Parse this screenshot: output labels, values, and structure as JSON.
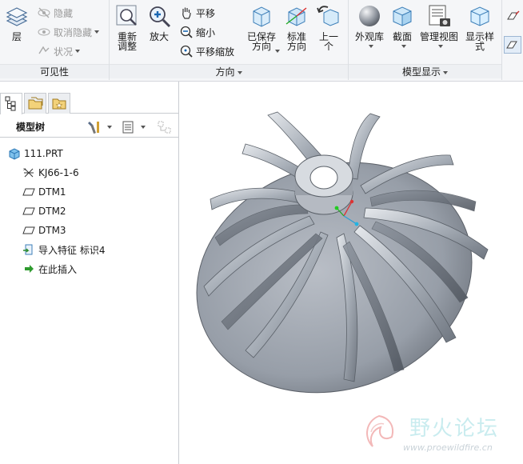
{
  "ribbon": {
    "visibility": {
      "layer_label": "层",
      "hide_label": "隐藏",
      "unhide_label": "取消隐藏",
      "status_label": "状况",
      "group_label": "可见性"
    },
    "orientation": {
      "refit_label": "重新\n调整",
      "zoom_in_label": "放大",
      "pan_label": "平移",
      "zoom_out_label": "缩小",
      "pan_zoom_label": "平移缩放",
      "saved_orientations_label": "已保存\n方向",
      "standard_orientation_label": "标准\n方向",
      "previous_label": "上一\n个",
      "group_label": "方向"
    },
    "model_display": {
      "appearance_gallery_label": "外观库",
      "section_label": "截面",
      "manage_views_label": "管理视图",
      "display_style_label": "显示样\n式",
      "group_label": "模型显示"
    }
  },
  "panel": {
    "tree_title": "模型树",
    "items": [
      {
        "label": "111.PRT",
        "icon": "part-icon"
      },
      {
        "label": "KJ66-1-6",
        "icon": "csys-icon"
      },
      {
        "label": "DTM1",
        "icon": "datum-plane-icon"
      },
      {
        "label": "DTM2",
        "icon": "datum-plane-icon"
      },
      {
        "label": "DTM3",
        "icon": "datum-plane-icon"
      },
      {
        "label": "导入特征 标识4",
        "icon": "import-feature-icon"
      },
      {
        "label": "在此插入",
        "icon": "insert-here-arrow-icon"
      }
    ]
  },
  "watermark": {
    "title": "野火论坛",
    "url": "www.proewildfire.cn"
  },
  "colors": {
    "model_grey": "#8c929c",
    "ribbon_bg": "#f5f6f8",
    "accent_blue": "#3a8fd6"
  }
}
